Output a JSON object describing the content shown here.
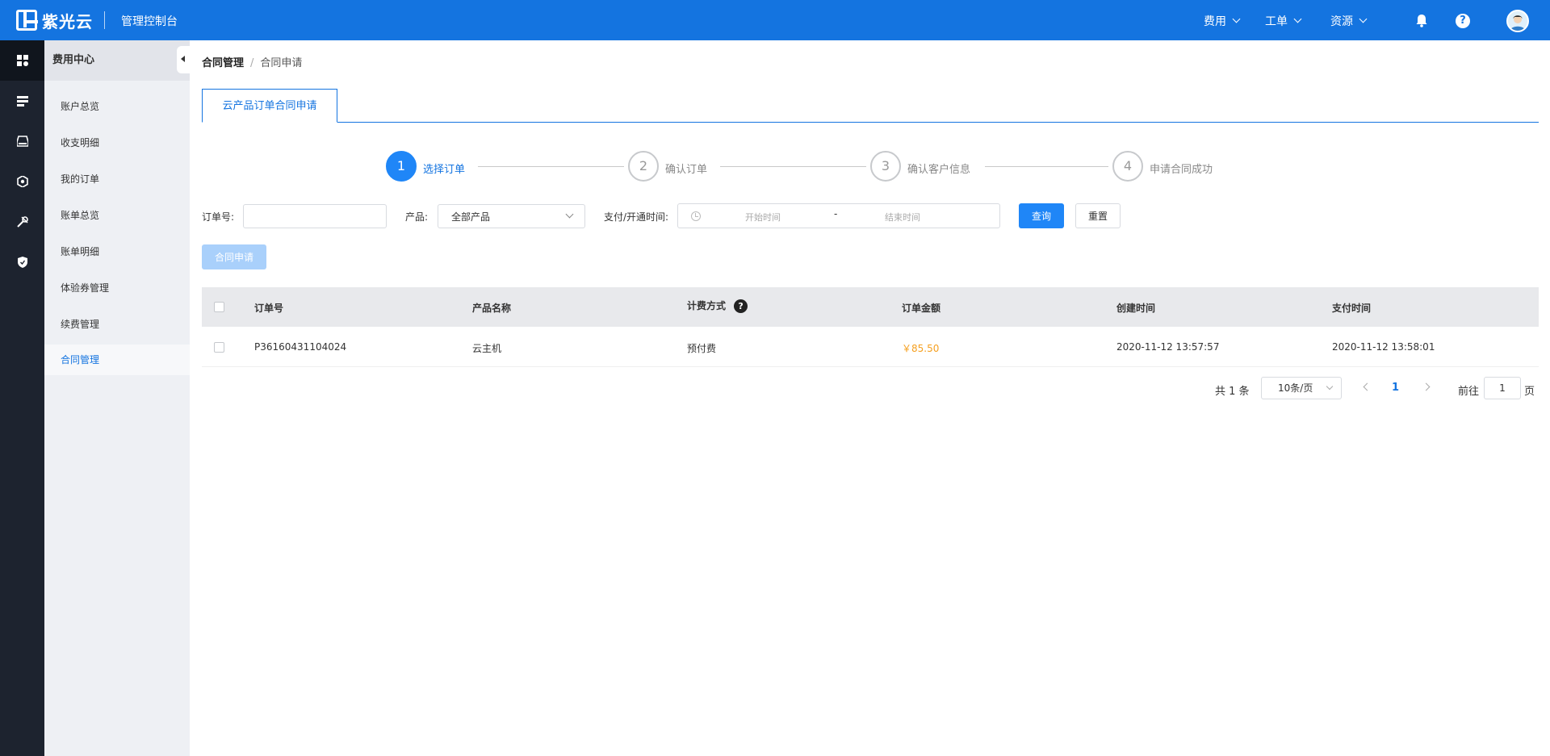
{
  "header": {
    "brand": "紫光云",
    "console_title": "管理控制台",
    "menus": [
      {
        "label": "费用"
      },
      {
        "label": "工单"
      },
      {
        "label": "资源"
      }
    ],
    "help_label": "?",
    "brand_color": "#1474e0"
  },
  "sidebar": {
    "title": "费用中心",
    "items": [
      {
        "label": "账户总览"
      },
      {
        "label": "收支明细"
      },
      {
        "label": "我的订单"
      },
      {
        "label": "账单总览"
      },
      {
        "label": "账单明细"
      },
      {
        "label": "体验券管理"
      },
      {
        "label": "续费管理"
      },
      {
        "label": "合同管理",
        "active": true
      }
    ]
  },
  "breadcrumb": {
    "root": "合同管理",
    "separator": "/",
    "current": "合同申请"
  },
  "tabs": [
    {
      "label": "云产品订单合同申请",
      "active": true
    }
  ],
  "steps": [
    {
      "num": "1",
      "label": "选择订单",
      "active": true
    },
    {
      "num": "2",
      "label": "确认订单"
    },
    {
      "num": "3",
      "label": "确认客户信息"
    },
    {
      "num": "4",
      "label": "申请合同成功"
    }
  ],
  "filters": {
    "order_no_label": "订单号:",
    "order_no_value": "",
    "product_label": "产品:",
    "product_value": "全部产品",
    "time_label": "支付/开通时间:",
    "start_placeholder": "开始时间",
    "range_separator": "-",
    "end_placeholder": "结束时间",
    "query_button": "查询",
    "reset_button": "重置"
  },
  "apply_button": "合同申请",
  "table": {
    "columns": [
      "订单号",
      "产品名称",
      "计费方式",
      "订单金额",
      "创建时间",
      "支付时间"
    ],
    "help_mark": "?",
    "rows": [
      {
        "order_no": "P36160431104024",
        "product": "云主机",
        "billing": "预付费",
        "amount": "￥85.50",
        "created": "2020-11-12 13:57:57",
        "paid": "2020-11-12 13:58:01"
      }
    ]
  },
  "pagination": {
    "total": "共 1 条",
    "page_size": "10条/页",
    "current_page": "1",
    "goto_label": "前往",
    "goto_value": "1",
    "page_suffix": "页"
  },
  "colors": {
    "primary": "#1f86f7",
    "price": "#f5a020",
    "sidebar_dark": "#1d232f"
  }
}
